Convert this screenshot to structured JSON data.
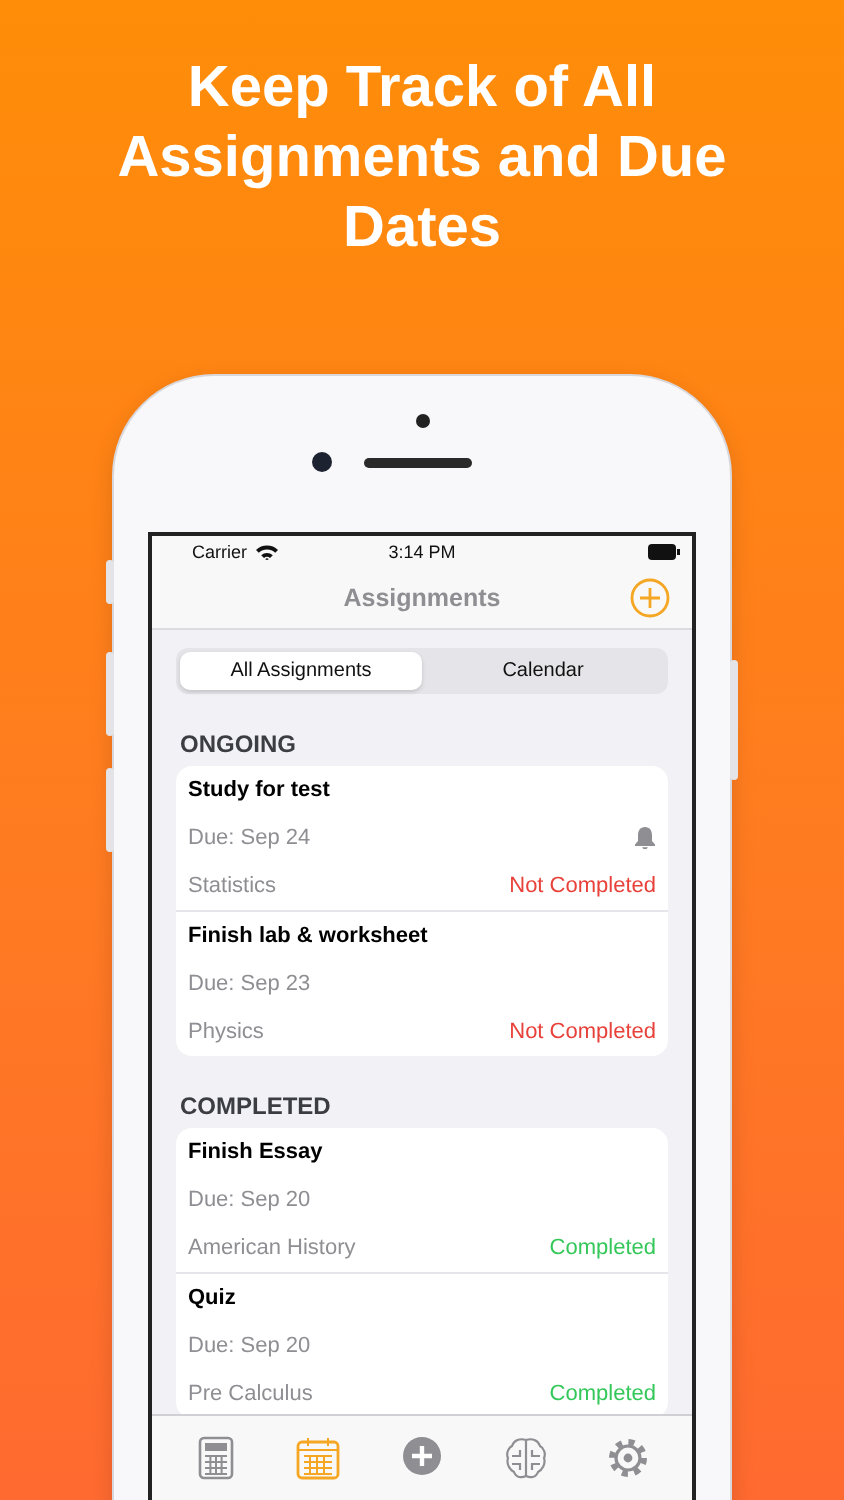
{
  "headline": "Keep Track of All Assignments and Due Dates",
  "status_bar": {
    "carrier": "Carrier",
    "time": "3:14 PM"
  },
  "nav": {
    "title": "Assignments"
  },
  "segments": [
    {
      "label": "All Assignments",
      "selected": true
    },
    {
      "label": "Calendar",
      "selected": false
    }
  ],
  "sections": [
    {
      "title": "ONGOING",
      "items": [
        {
          "title": "Study for test",
          "due": "Due: Sep 24",
          "subject": "Statistics",
          "status": "Not Completed",
          "completed": false,
          "reminder": true
        },
        {
          "title": "Finish lab & worksheet",
          "due": "Due: Sep 23",
          "subject": "Physics",
          "status": "Not Completed",
          "completed": false,
          "reminder": false
        }
      ]
    },
    {
      "title": "COMPLETED",
      "items": [
        {
          "title": "Finish Essay",
          "due": "Due: Sep 20",
          "subject": "American History",
          "status": "Completed",
          "completed": true,
          "reminder": false
        },
        {
          "title": "Quiz",
          "due": "Due: Sep 20",
          "subject": "Pre Calculus",
          "status": "Completed",
          "completed": true,
          "reminder": false
        }
      ]
    }
  ],
  "tab_bar": [
    {
      "kind": "calculator",
      "selected": false
    },
    {
      "kind": "calendar",
      "selected": true
    },
    {
      "kind": "add",
      "selected": false
    },
    {
      "kind": "brain",
      "selected": false
    },
    {
      "kind": "settings",
      "selected": false
    }
  ]
}
